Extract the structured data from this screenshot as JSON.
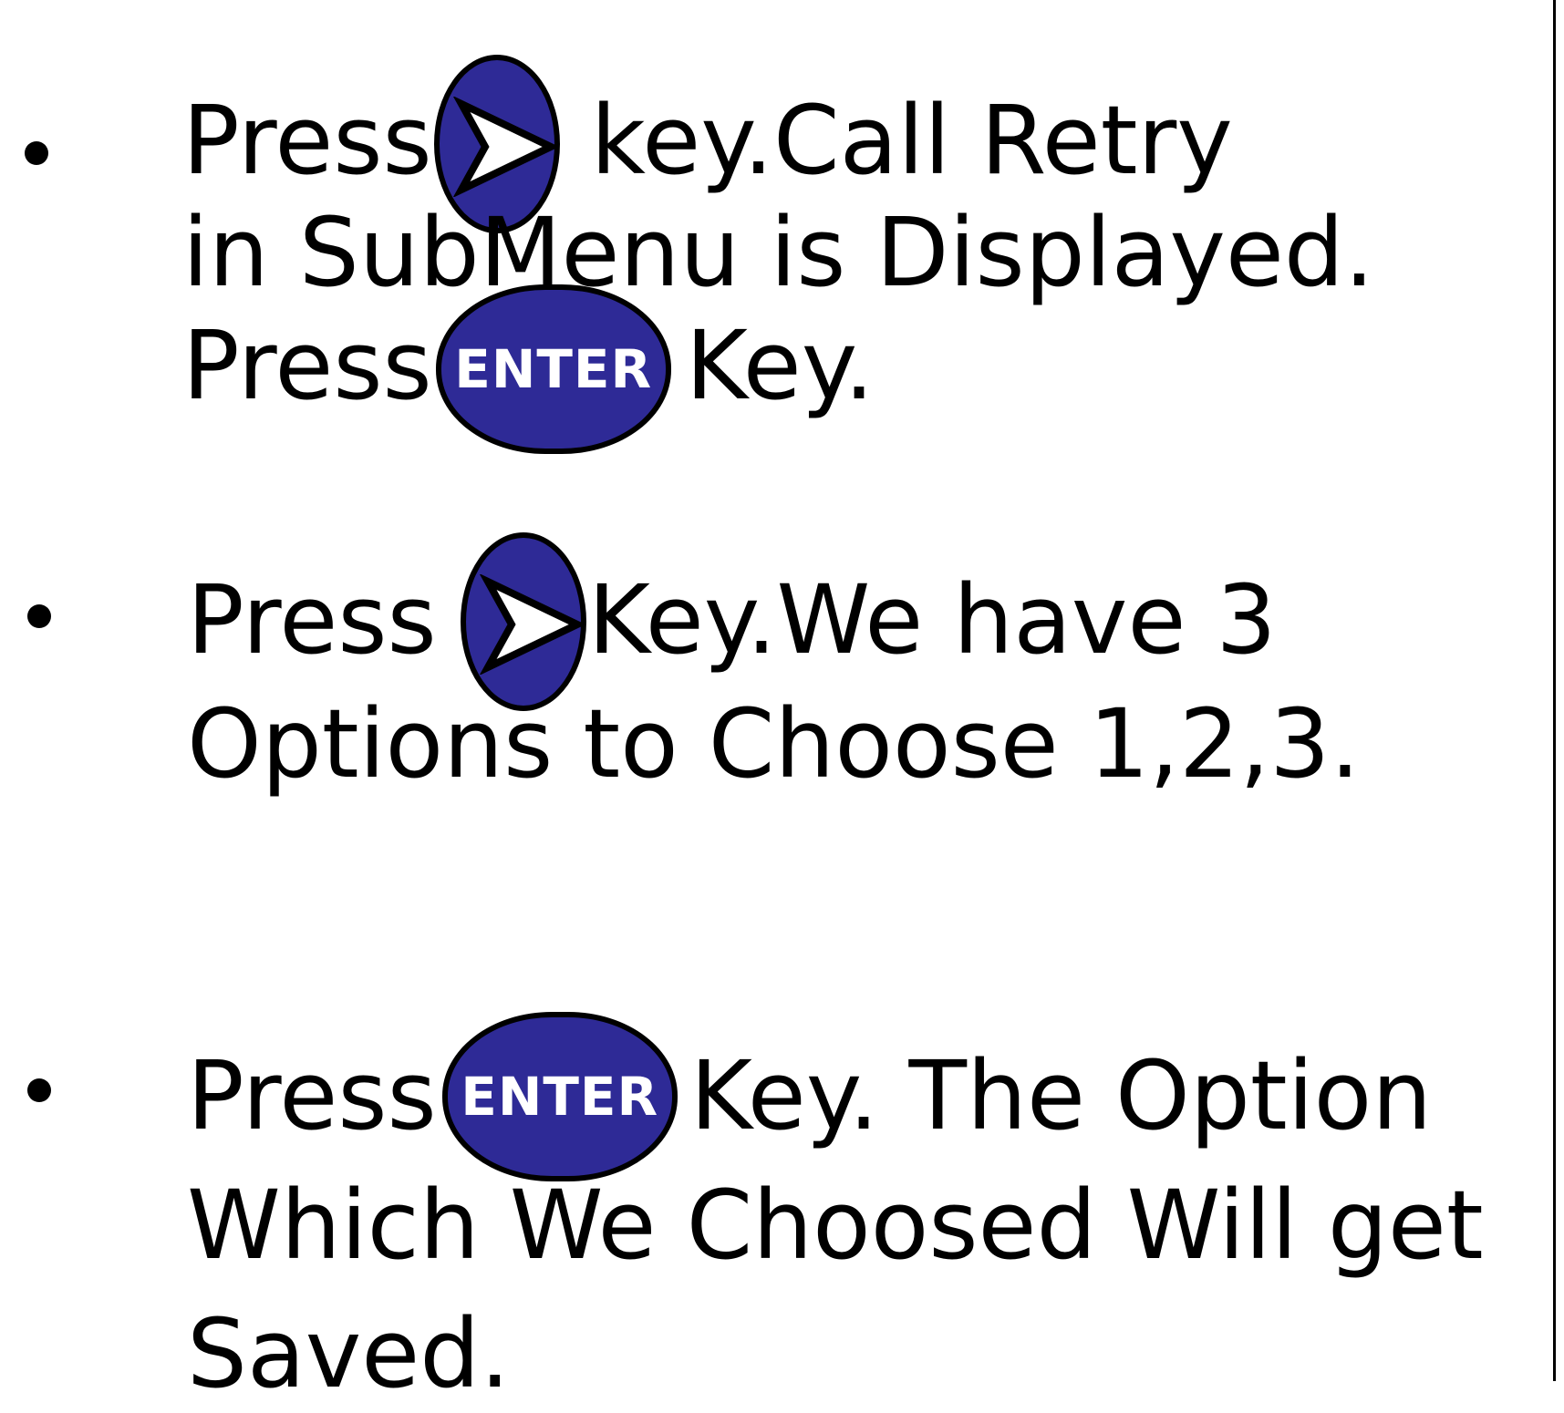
{
  "step1": {
    "line1_press": "Press",
    "line1_rest": "key.Call Retry",
    "line2": "in SubMenu  is Displayed.",
    "line3_press": "Press",
    "enter_label": "ENTER",
    "line3_rest": "Key."
  },
  "step2": {
    "line1_press": "Press",
    "line1_rest": "Key.We have 3",
    "line2": "Options to Choose 1,2,3."
  },
  "step3": {
    "line1_press": "Press",
    "enter_label": "ENTER",
    "line1_rest": "Key. The Option",
    "line2": "Which We Choosed Will get",
    "line3": "Saved."
  },
  "colors": {
    "key_fill": "#2e2a96",
    "key_outline": "#000000",
    "key_text": "#ffffff",
    "text": "#000000"
  },
  "icons": {
    "arrow_key": "right-arrow-key-icon",
    "enter_key": "enter-key-icon"
  }
}
